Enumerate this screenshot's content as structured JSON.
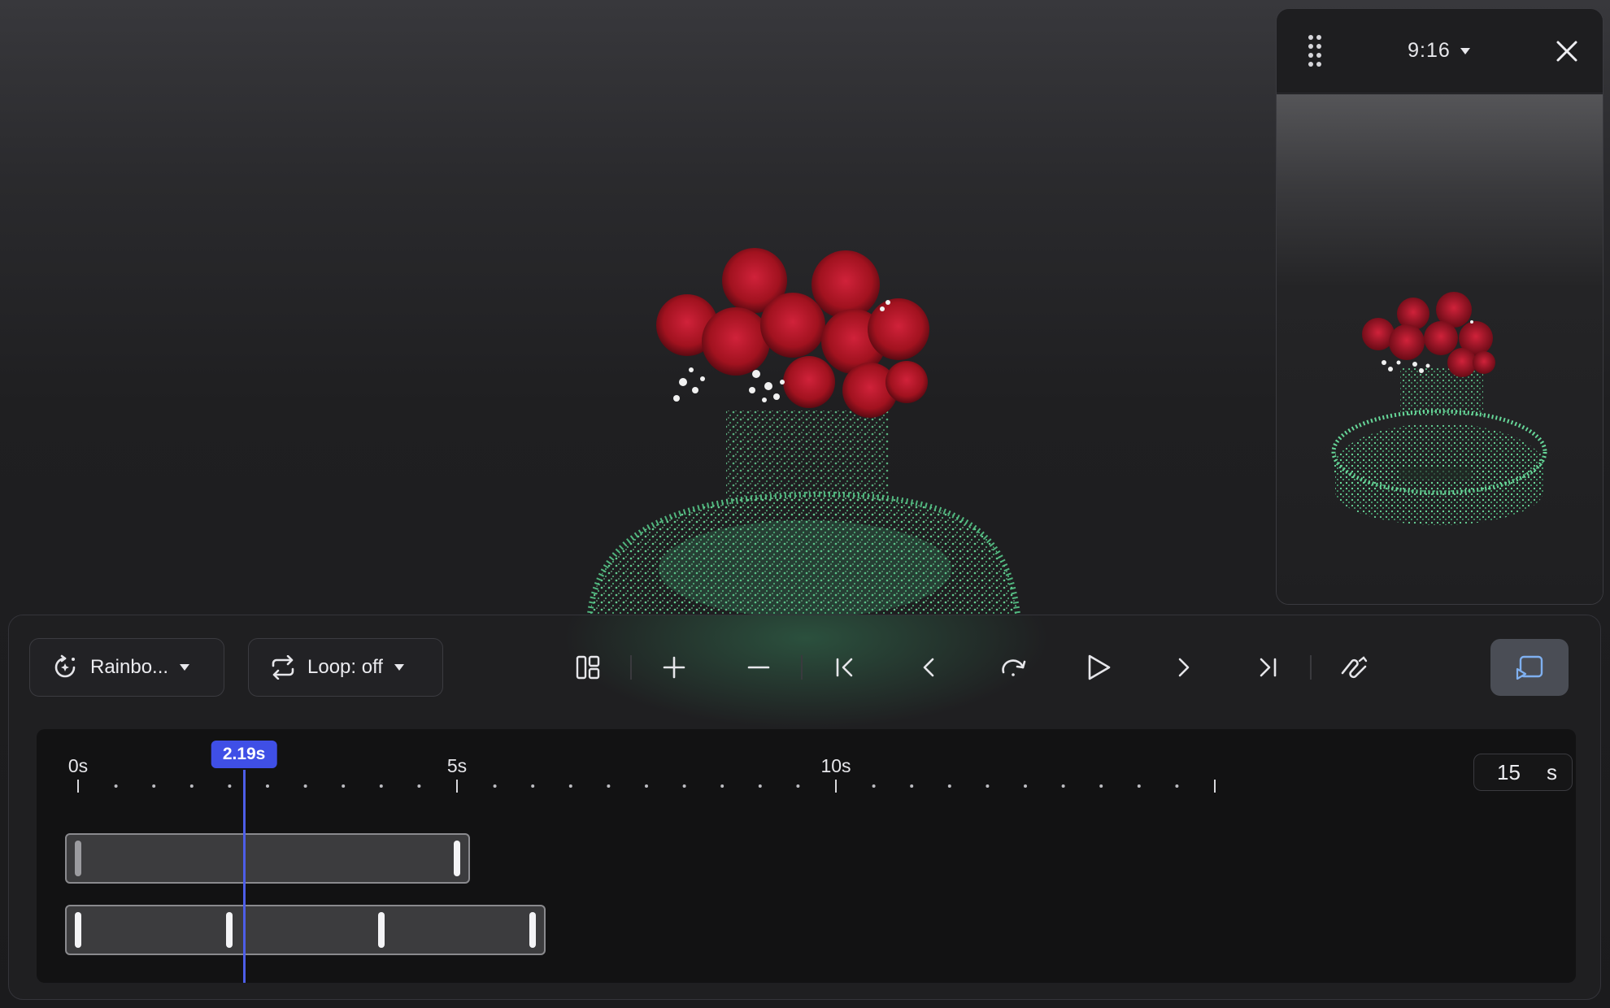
{
  "preview": {
    "aspect_ratio": "9:16",
    "drag_icon": "drag-handle-icon",
    "close_icon": "close-icon",
    "chevron_icon": "caret-down-icon"
  },
  "controls": {
    "effect_dropdown": {
      "label": "Rainbo...",
      "icon": "sparkle-rotate-icon"
    },
    "loop_dropdown": {
      "label": "Loop: off",
      "icon": "loop-icon"
    },
    "toolbar": [
      "layout-icon",
      "plus-icon",
      "minus-icon",
      "skip-to-start-icon",
      "step-back-icon",
      "redo-icon",
      "play-icon",
      "step-forward-icon",
      "skip-to-end-icon",
      "path-tool-icon"
    ],
    "cast_button_icon": "cast-icon"
  },
  "timeline": {
    "labels": [
      {
        "text": "0s",
        "t": 0
      },
      {
        "text": "5s",
        "t": 5
      },
      {
        "text": "10s",
        "t": 10
      }
    ],
    "duration": {
      "value": "15",
      "unit": "s"
    },
    "playhead": {
      "label": "2.19s",
      "time": 2.19
    },
    "tracks": [
      {
        "start": 0,
        "end": 5,
        "keyframes": [
          0,
          5
        ]
      },
      {
        "start": 0,
        "end": 6,
        "keyframes": [
          0,
          2,
          4,
          6
        ]
      }
    ]
  },
  "colors": {
    "accent": "#3f4fe6",
    "rose_red": "#b5142a",
    "point_green": "#5fd08e",
    "panel_bg": "#1f1f21"
  }
}
